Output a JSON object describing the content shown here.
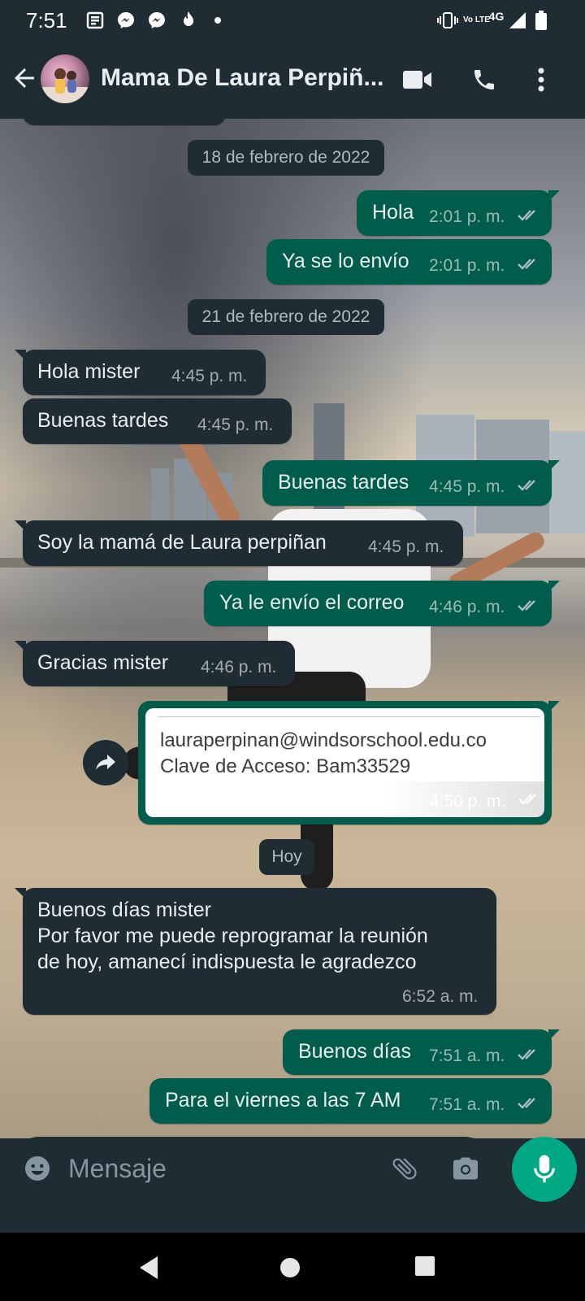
{
  "status_bar": {
    "time": "7:51",
    "volte_label": "Vo LTE",
    "network": "4G"
  },
  "header": {
    "contact_name": "Mama De Laura Perpiñ..."
  },
  "chat": {
    "date_chips": [
      "18 de febrero de 2022",
      "21 de febrero de 2022",
      "Hoy"
    ],
    "messages": [
      {
        "dir": "out",
        "text": "Hola",
        "time": "2:01 p. m."
      },
      {
        "dir": "out",
        "text": "Ya se lo envío",
        "time": "2:01 p. m."
      },
      {
        "dir": "in",
        "text": "Hola mister",
        "time": "4:45 p. m."
      },
      {
        "dir": "in",
        "text": "Buenas tardes",
        "time": "4:45 p. m."
      },
      {
        "dir": "out",
        "text": "Buenas tardes",
        "time": "4:45 p. m."
      },
      {
        "dir": "in",
        "text": "Soy la mamá de Laura perpiñan",
        "time": "4:45 p. m."
      },
      {
        "dir": "out",
        "text": "Ya le envío el correo",
        "time": "4:46 p. m."
      },
      {
        "dir": "in",
        "text": "Gracias mister",
        "time": "4:46 p. m."
      },
      {
        "dir": "out",
        "type": "image",
        "line1": "lauraperpinan@windsorschool.edu.co",
        "line2": "Clave de Acceso: Bam33529",
        "time": "4:50 p. m."
      },
      {
        "dir": "in",
        "lines": [
          "Buenos días mister",
          "Por favor me puede reprogramar la reunión",
          "de hoy, amanecí indispuesta le agradezco"
        ],
        "time": "6:52 a. m."
      },
      {
        "dir": "out",
        "text": "Buenos días",
        "time": "7:51 a. m."
      },
      {
        "dir": "out",
        "text": "Para el viernes a las 7 AM",
        "time": "7:51 a. m."
      }
    ]
  },
  "composer": {
    "placeholder": "Mensaje"
  },
  "colors": {
    "header_bg": "#1f2c34",
    "incoming_bubble": "#1f2c34",
    "outgoing_bubble": "#005c4b",
    "read_ticks": "#53bdeb",
    "mic_button": "#00a884"
  }
}
